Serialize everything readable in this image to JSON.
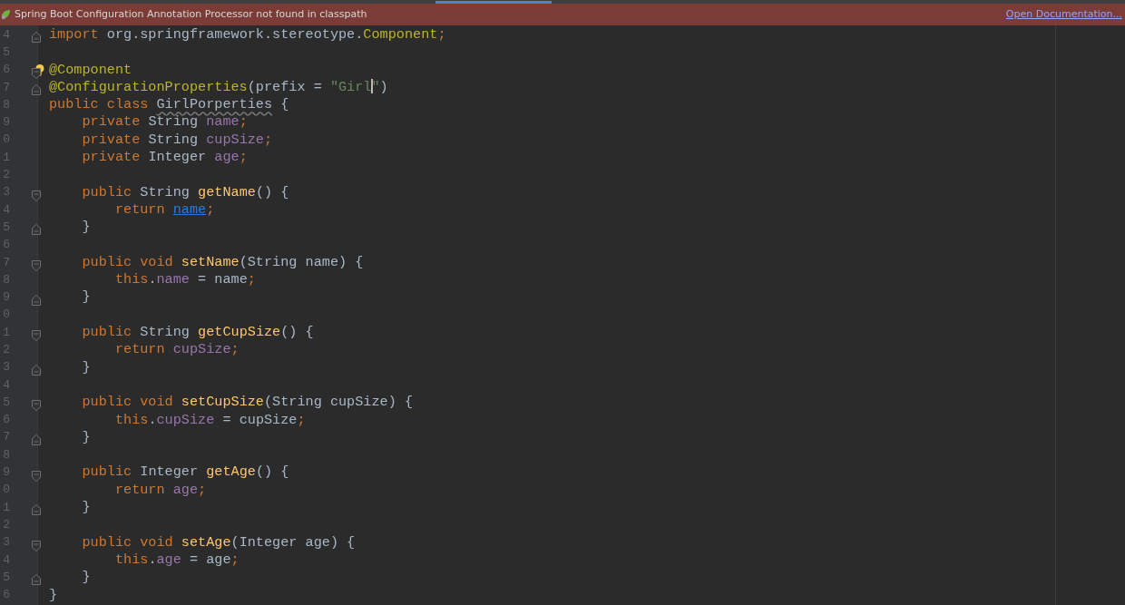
{
  "banner": {
    "message": "Spring Boot Configuration Annotation Processor not found in classpath",
    "link": "Open Documentation..."
  },
  "editor": {
    "lines": [
      {
        "number": "4",
        "fold_start": false,
        "fold_end": true,
        "tokens": [
          {
            "text": "import",
            "kind": "keyword"
          },
          {
            "text": " org.springframework.stereotype.",
            "kind": "plain"
          },
          {
            "text": "Component",
            "kind": "annotation"
          },
          {
            "text": ";",
            "kind": "keyword"
          }
        ]
      },
      {
        "number": "5",
        "fold_start": false,
        "fold_end": false
      },
      {
        "number": "6",
        "fold_start": true,
        "fold_end": false,
        "intention": true,
        "tokens": [
          {
            "text": "@Component",
            "kind": "annotation"
          }
        ]
      },
      {
        "number": "7",
        "fold_start": false,
        "fold_end": true,
        "tokens": [
          {
            "text": "@ConfigurationProperties",
            "kind": "annotation"
          },
          {
            "text": "(prefix = ",
            "kind": "plain"
          },
          {
            "text": "\"Girl",
            "kind": "string",
            "caret": true
          },
          {
            "text": "\"",
            "kind": "string"
          },
          {
            "text": ")",
            "kind": "plain"
          }
        ]
      },
      {
        "number": "8",
        "fold_start": false,
        "fold_end": false,
        "tokens": [
          {
            "text": "public class ",
            "kind": "keyword"
          },
          {
            "text": "GirlPorperties",
            "kind": "unused"
          },
          {
            "text": " {",
            "kind": "plain"
          }
        ]
      },
      {
        "number": "9",
        "fold_start": false,
        "fold_end": false,
        "tokens": [
          {
            "text": "    private ",
            "kind": "keyword"
          },
          {
            "text": "String ",
            "kind": "plain"
          },
          {
            "text": "name",
            "kind": "field"
          },
          {
            "text": ";",
            "kind": "keyword"
          }
        ]
      },
      {
        "number": "0",
        "fold_start": false,
        "fold_end": false,
        "tokens": [
          {
            "text": "    private ",
            "kind": "keyword"
          },
          {
            "text": "String ",
            "kind": "plain"
          },
          {
            "text": "cupSize",
            "kind": "field"
          },
          {
            "text": ";",
            "kind": "keyword"
          }
        ]
      },
      {
        "number": "1",
        "fold_start": false,
        "fold_end": false,
        "tokens": [
          {
            "text": "    private ",
            "kind": "keyword"
          },
          {
            "text": "Integer ",
            "kind": "plain"
          },
          {
            "text": "age",
            "kind": "field"
          },
          {
            "text": ";",
            "kind": "keyword"
          }
        ]
      },
      {
        "number": "2",
        "fold_start": false,
        "fold_end": false
      },
      {
        "number": "3",
        "fold_start": true,
        "fold_end": false,
        "tokens": [
          {
            "text": "    public ",
            "kind": "keyword"
          },
          {
            "text": "String ",
            "kind": "plain"
          },
          {
            "text": "getName",
            "kind": "method"
          },
          {
            "text": "() {",
            "kind": "plain"
          }
        ]
      },
      {
        "number": "4",
        "fold_start": false,
        "fold_end": false,
        "tokens": [
          {
            "text": "        return ",
            "kind": "keyword"
          },
          {
            "text": "name",
            "kind": "link"
          },
          {
            "text": ";",
            "kind": "keyword"
          }
        ]
      },
      {
        "number": "5",
        "fold_start": false,
        "fold_end": true,
        "tokens": [
          {
            "text": "    }",
            "kind": "plain"
          }
        ]
      },
      {
        "number": "6",
        "fold_start": false,
        "fold_end": false
      },
      {
        "number": "7",
        "fold_start": true,
        "fold_end": false,
        "tokens": [
          {
            "text": "    public void ",
            "kind": "keyword"
          },
          {
            "text": "setName",
            "kind": "method"
          },
          {
            "text": "(String name) {",
            "kind": "plain"
          }
        ]
      },
      {
        "number": "8",
        "fold_start": false,
        "fold_end": false,
        "tokens": [
          {
            "text": "        this",
            "kind": "keyword"
          },
          {
            "text": ".",
            "kind": "plain"
          },
          {
            "text": "name",
            "kind": "field"
          },
          {
            "text": " = name",
            "kind": "plain"
          },
          {
            "text": ";",
            "kind": "keyword"
          }
        ]
      },
      {
        "number": "9",
        "fold_start": false,
        "fold_end": true,
        "tokens": [
          {
            "text": "    }",
            "kind": "plain"
          }
        ]
      },
      {
        "number": "0",
        "fold_start": false,
        "fold_end": false
      },
      {
        "number": "1",
        "fold_start": true,
        "fold_end": false,
        "tokens": [
          {
            "text": "    public ",
            "kind": "keyword"
          },
          {
            "text": "String ",
            "kind": "plain"
          },
          {
            "text": "getCupSize",
            "kind": "method"
          },
          {
            "text": "() {",
            "kind": "plain"
          }
        ]
      },
      {
        "number": "2",
        "fold_start": false,
        "fold_end": false,
        "tokens": [
          {
            "text": "        return ",
            "kind": "keyword"
          },
          {
            "text": "cupSize",
            "kind": "field"
          },
          {
            "text": ";",
            "kind": "keyword"
          }
        ]
      },
      {
        "number": "3",
        "fold_start": false,
        "fold_end": true,
        "tokens": [
          {
            "text": "    }",
            "kind": "plain"
          }
        ]
      },
      {
        "number": "4",
        "fold_start": false,
        "fold_end": false
      },
      {
        "number": "5",
        "fold_start": true,
        "fold_end": false,
        "tokens": [
          {
            "text": "    public void ",
            "kind": "keyword"
          },
          {
            "text": "setCupSize",
            "kind": "method"
          },
          {
            "text": "(String cupSize) {",
            "kind": "plain"
          }
        ]
      },
      {
        "number": "6",
        "fold_start": false,
        "fold_end": false,
        "tokens": [
          {
            "text": "        this",
            "kind": "keyword"
          },
          {
            "text": ".",
            "kind": "plain"
          },
          {
            "text": "cupSize",
            "kind": "field"
          },
          {
            "text": " = cupSize",
            "kind": "plain"
          },
          {
            "text": ";",
            "kind": "keyword"
          }
        ]
      },
      {
        "number": "7",
        "fold_start": false,
        "fold_end": true,
        "tokens": [
          {
            "text": "    }",
            "kind": "plain"
          }
        ]
      },
      {
        "number": "8",
        "fold_start": false,
        "fold_end": false
      },
      {
        "number": "9",
        "fold_start": true,
        "fold_end": false,
        "tokens": [
          {
            "text": "    public ",
            "kind": "keyword"
          },
          {
            "text": "Integer ",
            "kind": "plain"
          },
          {
            "text": "getAge",
            "kind": "method"
          },
          {
            "text": "() {",
            "kind": "plain"
          }
        ]
      },
      {
        "number": "0",
        "fold_start": false,
        "fold_end": false,
        "tokens": [
          {
            "text": "        return ",
            "kind": "keyword"
          },
          {
            "text": "age",
            "kind": "field"
          },
          {
            "text": ";",
            "kind": "keyword"
          }
        ]
      },
      {
        "number": "1",
        "fold_start": false,
        "fold_end": true,
        "tokens": [
          {
            "text": "    }",
            "kind": "plain"
          }
        ]
      },
      {
        "number": "2",
        "fold_start": false,
        "fold_end": false
      },
      {
        "number": "3",
        "fold_start": true,
        "fold_end": false,
        "tokens": [
          {
            "text": "    public void ",
            "kind": "keyword"
          },
          {
            "text": "setAge",
            "kind": "method"
          },
          {
            "text": "(Integer age) {",
            "kind": "plain"
          }
        ]
      },
      {
        "number": "4",
        "fold_start": false,
        "fold_end": false,
        "tokens": [
          {
            "text": "        this",
            "kind": "keyword"
          },
          {
            "text": ".",
            "kind": "plain"
          },
          {
            "text": "age",
            "kind": "field"
          },
          {
            "text": " = age",
            "kind": "plain"
          },
          {
            "text": ";",
            "kind": "keyword"
          }
        ]
      },
      {
        "number": "5",
        "fold_start": false,
        "fold_end": true,
        "tokens": [
          {
            "text": "    }",
            "kind": "plain"
          }
        ]
      },
      {
        "number": "6",
        "fold_start": false,
        "fold_end": false,
        "tokens": [
          {
            "text": "}",
            "kind": "plain"
          }
        ]
      }
    ]
  }
}
